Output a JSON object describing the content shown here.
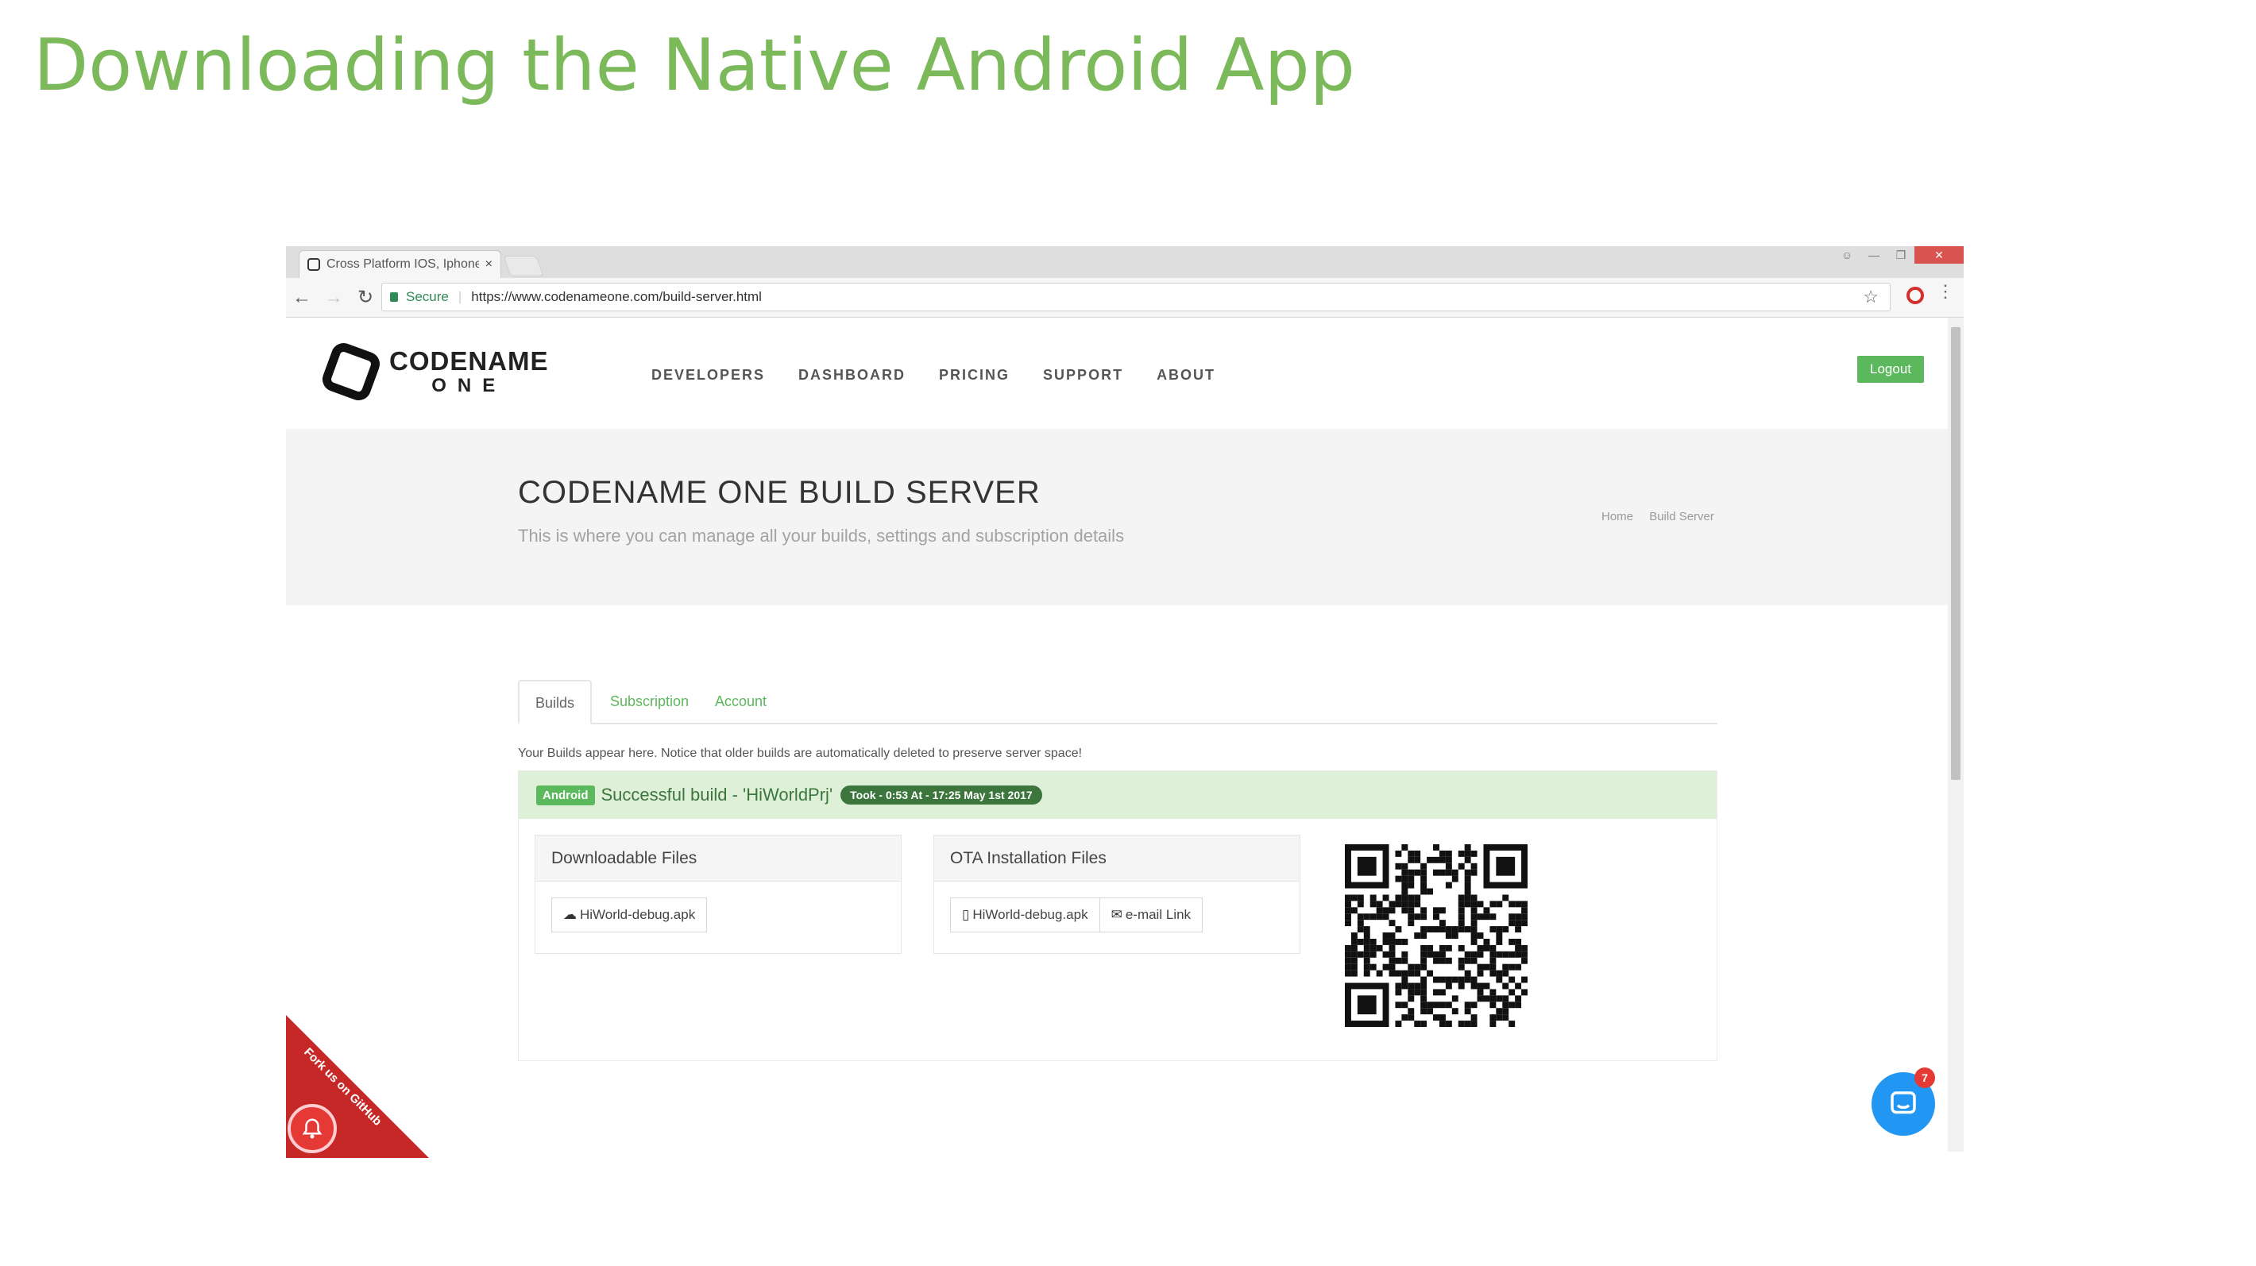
{
  "slide": {
    "title": "Downloading the Native Android App"
  },
  "browser": {
    "tab_title": "Cross Platform IOS, Iphone",
    "tab_close": "×",
    "secure_label": "Secure",
    "url": "https://www.codenameone.com/build-server.html",
    "icons": [
      "back-arrow-icon",
      "forward-arrow-icon",
      "reload-icon",
      "lock-icon",
      "star-icon",
      "opera-icon",
      "menu-dots-icon"
    ]
  },
  "site": {
    "logo_line1": "CODENAME",
    "logo_line2": "ONE",
    "nav": [
      "DEVELOPERS",
      "DASHBOARD",
      "PRICING",
      "SUPPORT",
      "ABOUT"
    ],
    "logout_label": "Logout",
    "brand_color": "#5cb85c"
  },
  "hero": {
    "title": "CODENAME ONE BUILD SERVER",
    "subtitle": "This is where you can manage all your builds, settings and subscription details",
    "breadcrumb": [
      "Home",
      "Build Server"
    ]
  },
  "tabs": [
    "Builds",
    "Subscription",
    "Account"
  ],
  "notice": "Your Builds appear here. Notice that older builds are automatically deleted to preserve server space!",
  "build": {
    "platform": "Android",
    "status": "Successful build - 'HiWorldPrj'",
    "took": "Took - 0:53 At - 17:25 May 1st 2017",
    "downloadable_title": "Downloadable Files",
    "downloadable_file": "HiWorld-debug.apk",
    "ota_title": "OTA Installation Files",
    "ota_file": "HiWorld-debug.apk",
    "email_link": "e-mail Link"
  },
  "ribbon": {
    "text": "Fork us on GitHub"
  },
  "chat_badge": "7"
}
